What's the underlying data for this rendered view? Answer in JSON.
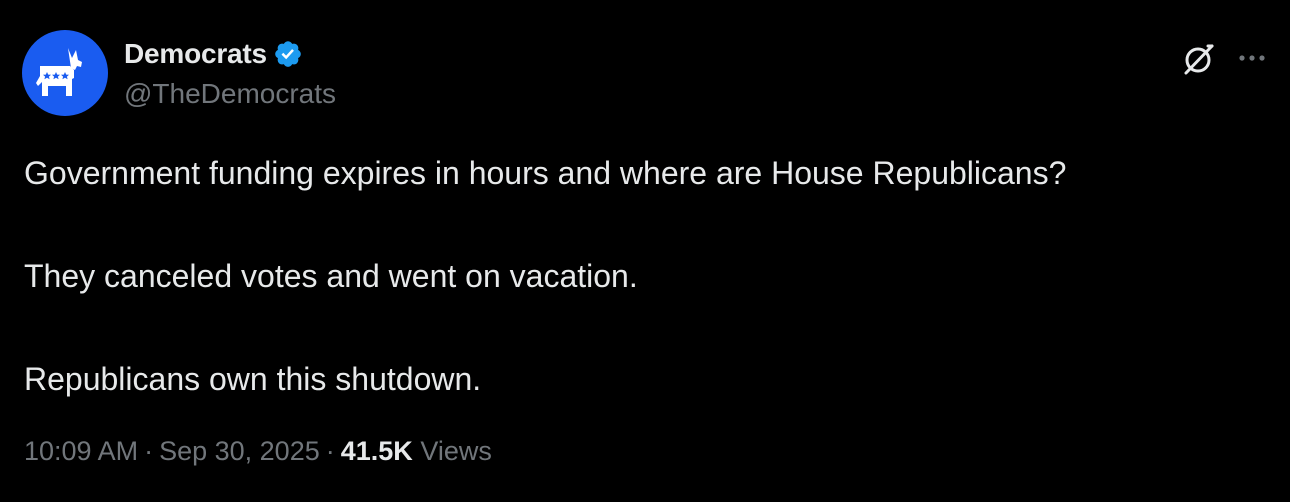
{
  "account": {
    "display_name": "Democrats",
    "handle": "@TheDemocrats",
    "verified": true,
    "avatar_icon": "donkey-logo-icon",
    "avatar_color": "#1a5cf0"
  },
  "actions": {
    "grok_icon": "grok-icon",
    "more_icon": "more-icon"
  },
  "tweet": {
    "paragraphs": [
      "Government funding expires in hours and where are House Republicans?",
      "They canceled votes and went on vacation.",
      "Republicans own this shutdown."
    ]
  },
  "meta": {
    "time": "10:09 AM",
    "date": "Sep 30, 2025",
    "separator": "·",
    "views_count": "41.5K",
    "views_label": "Views"
  },
  "colors": {
    "background": "#000000",
    "primary_text": "#e7e9ea",
    "secondary_text": "#71767b",
    "verified_blue": "#1d9bf0"
  }
}
